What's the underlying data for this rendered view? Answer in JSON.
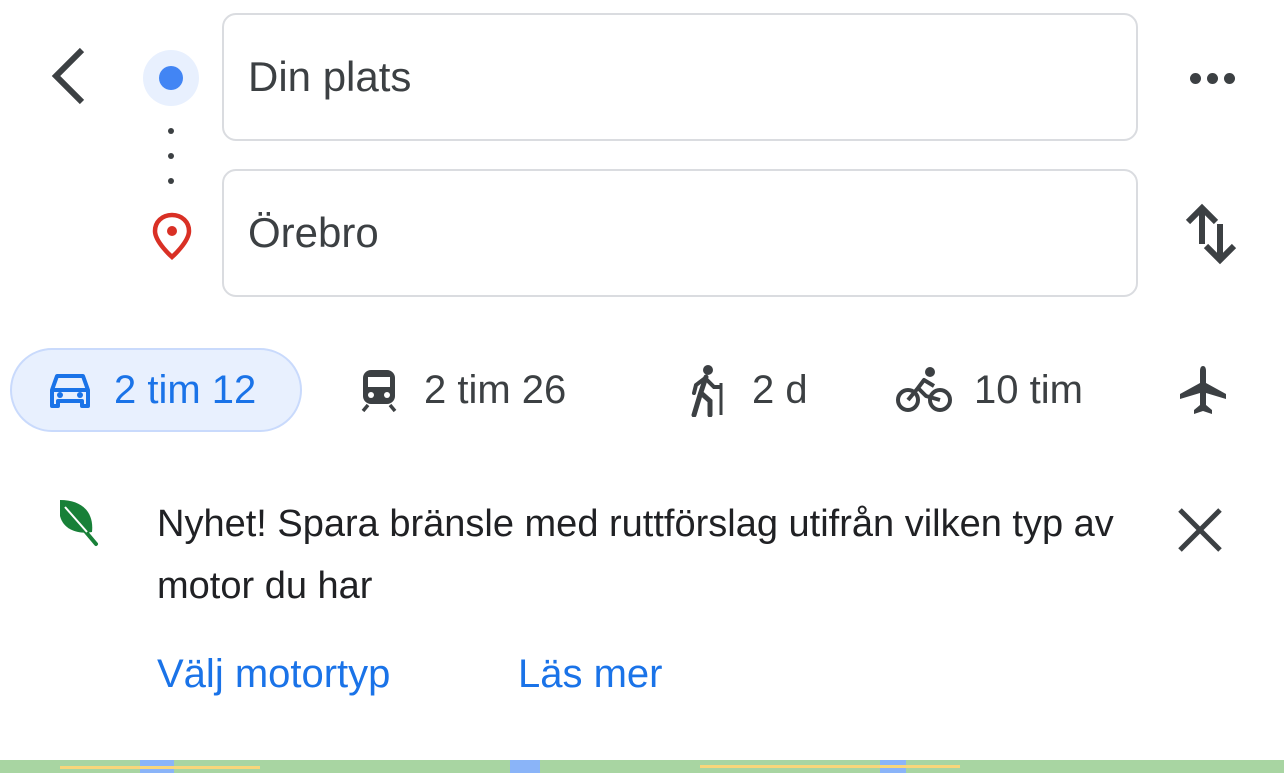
{
  "header": {
    "origin_value": "Din plats",
    "destination_value": "Örebro"
  },
  "icons": {
    "back": "chevron-left-icon",
    "origin": "current-location-dot-icon",
    "destination": "map-pin-icon",
    "more": "more-horizontal-icon",
    "swap": "swap-vertical-icon",
    "close": "close-icon",
    "leaf": "eco-leaf-icon"
  },
  "modes": [
    {
      "mode": "car",
      "label": "2 tim 12",
      "selected": true,
      "icon": "car-icon"
    },
    {
      "mode": "transit",
      "label": "2 tim 26",
      "selected": false,
      "icon": "train-icon"
    },
    {
      "mode": "walk",
      "label": "2 d",
      "selected": false,
      "icon": "hiking-icon"
    },
    {
      "mode": "bike",
      "label": "10 tim",
      "selected": false,
      "icon": "bicycle-icon"
    },
    {
      "mode": "flight",
      "label": "",
      "selected": false,
      "icon": "airplane-icon"
    }
  ],
  "notice": {
    "text": "Nyhet! Spara bränsle med ruttförslag utifrån vilken typ av motor du har",
    "link_engine": "Välj motortyp",
    "link_more": "Läs mer"
  },
  "colors": {
    "accent": "#1a73e8",
    "origin_dot": "#4285f4",
    "pin": "#d93025",
    "leaf": "#188038",
    "selected_chip_bg": "#e8f0fe"
  }
}
